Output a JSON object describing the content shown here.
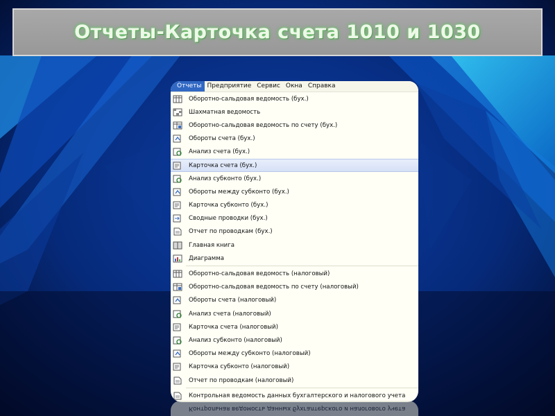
{
  "slide": {
    "title": "Отчеты-Карточка счета 1010 и 1030"
  },
  "menubar": {
    "items": [
      {
        "label": "Отчеты",
        "active": true
      },
      {
        "label": "Предприятие"
      },
      {
        "label": "Сервис"
      },
      {
        "label": "Окна"
      },
      {
        "label": "Справка"
      }
    ]
  },
  "menu": {
    "group1": [
      {
        "label": "Оборотно-сальдовая ведомость (бух.)",
        "icon": "table-report-icon"
      },
      {
        "label": "Шахматная ведомость",
        "icon": "grid-report-icon"
      },
      {
        "label": "Оборотно-сальдовая ведомость по счету (бух.)",
        "icon": "table-account-icon"
      },
      {
        "label": "Обороты счета (бух.)",
        "icon": "turnover-icon"
      },
      {
        "label": "Анализ счета (бух.)",
        "icon": "analysis-icon"
      },
      {
        "label": "Карточка счета (бух.)",
        "icon": "card-icon",
        "selected": true
      },
      {
        "label": "Анализ субконто (бух.)",
        "icon": "analysis-icon"
      },
      {
        "label": "Обороты между субконто (бух.)",
        "icon": "turnover-icon"
      },
      {
        "label": "Карточка субконто (бух.)",
        "icon": "card-icon"
      },
      {
        "label": "Сводные проводки (бух.)",
        "icon": "entries-icon"
      },
      {
        "label": "Отчет по проводкам (бух.)",
        "icon": "document-icon"
      },
      {
        "label": "Главная книга",
        "icon": "ledger-icon"
      },
      {
        "label": "Диаграмма",
        "icon": "chart-icon"
      }
    ],
    "group2": [
      {
        "label": "Оборотно-сальдовая ведомость (налоговый)",
        "icon": "table-report-icon"
      },
      {
        "label": "Оборотно-сальдовая ведомость по счету (налоговый)",
        "icon": "table-account-icon"
      },
      {
        "label": "Обороты счета (налоговый)",
        "icon": "turnover-icon"
      },
      {
        "label": "Анализ счета (налоговый)",
        "icon": "analysis-icon"
      },
      {
        "label": "Карточка счета (налоговый)",
        "icon": "card-icon"
      },
      {
        "label": "Анализ субконто (налоговый)",
        "icon": "analysis-icon"
      },
      {
        "label": "Обороты между субконто (налоговый)",
        "icon": "turnover-icon"
      },
      {
        "label": "Карточка субконто (налоговый)",
        "icon": "card-icon"
      },
      {
        "label": "Отчет по проводкам (налоговый)",
        "icon": "document-icon"
      }
    ],
    "group3": [
      {
        "label": "Контрольная ведомость данных бухгалтерского и налогового учета",
        "icon": "document-icon"
      }
    ]
  },
  "colors": {
    "menu_bg": "#fffff6",
    "menu_highlight": "#3168c4",
    "selection": "#d6e1f7",
    "title_glow": "#5cb85c"
  }
}
